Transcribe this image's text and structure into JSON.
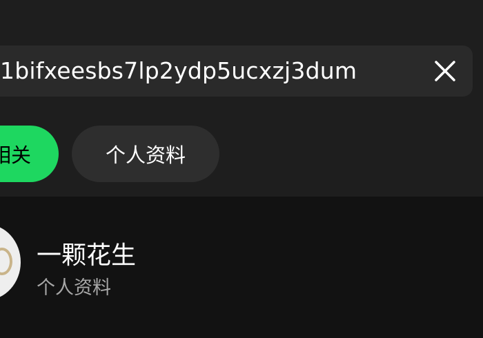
{
  "search": {
    "query": "1bifxeesbs7lp2ydp5ucxzj3dum"
  },
  "filters": {
    "chips": [
      {
        "label": "相关",
        "active": true
      },
      {
        "label": "个人资料",
        "active": false
      }
    ]
  },
  "results": [
    {
      "title": "一颗花生",
      "subtitle": "个人资料"
    }
  ],
  "colors": {
    "background": "#121212",
    "panel": "#1e1e1e",
    "search_field": "#2a2a2a",
    "accent": "#1ed760",
    "chip_inactive": "#2e2e2e",
    "text_primary": "#ffffff",
    "text_secondary": "#a7a7a7"
  },
  "icons": {
    "clear": "close-icon"
  }
}
